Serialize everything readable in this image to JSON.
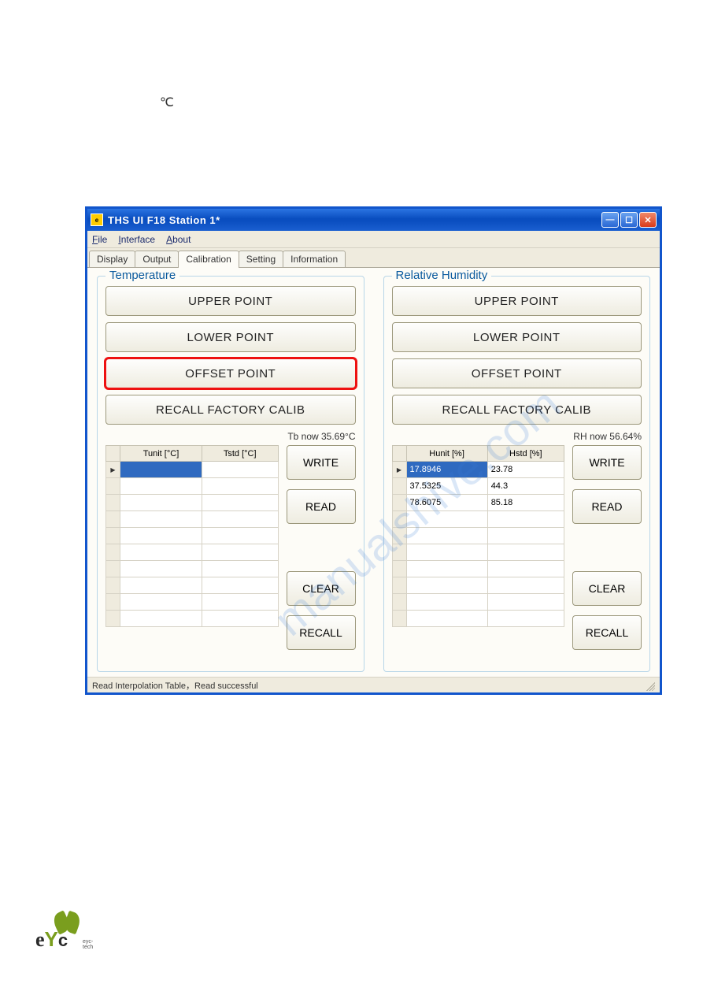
{
  "celsius_symbol": "℃",
  "window": {
    "title": "THS UI F18  Station 1*"
  },
  "menu": {
    "file": "File",
    "interface": "Interface",
    "about": "About"
  },
  "tabs": {
    "display": "Display",
    "output": "Output",
    "calibration": "Calibration",
    "setting": "Setting",
    "information": "Information"
  },
  "temp": {
    "legend": "Temperature",
    "upper": "UPPER POINT",
    "lower": "LOWER POINT",
    "offset": "OFFSET POINT",
    "recall_factory": "RECALL FACTORY CALIB",
    "now": "Tb now 35.69°C",
    "col1": "Tunit [°C]",
    "col2": "Tstd [°C]",
    "rows": [
      {
        "u": "",
        "s": ""
      },
      {
        "u": "",
        "s": ""
      },
      {
        "u": "",
        "s": ""
      },
      {
        "u": "",
        "s": ""
      },
      {
        "u": "",
        "s": ""
      },
      {
        "u": "",
        "s": ""
      },
      {
        "u": "",
        "s": ""
      },
      {
        "u": "",
        "s": ""
      },
      {
        "u": "",
        "s": ""
      },
      {
        "u": "",
        "s": ""
      }
    ]
  },
  "hum": {
    "legend": "Relative Humidity",
    "upper": "UPPER POINT",
    "lower": "LOWER POINT",
    "offset": "OFFSET POINT",
    "recall_factory": "RECALL FACTORY CALIB",
    "now": "RH now 56.64%",
    "col1": "Hunit [%]",
    "col2": "Hstd [%]",
    "rows": [
      {
        "u": "17.8946",
        "s": "23.78"
      },
      {
        "u": "37.5325",
        "s": "44.3"
      },
      {
        "u": "78.6075",
        "s": "85.18"
      },
      {
        "u": "",
        "s": ""
      },
      {
        "u": "",
        "s": ""
      },
      {
        "u": "",
        "s": ""
      },
      {
        "u": "",
        "s": ""
      },
      {
        "u": "",
        "s": ""
      },
      {
        "u": "",
        "s": ""
      },
      {
        "u": "",
        "s": ""
      }
    ]
  },
  "buttons": {
    "write": "WRITE",
    "read": "READ",
    "clear": "CLEAR",
    "recall": "RECALL"
  },
  "status": "Read Interpolation Table，Read successful",
  "watermark": "manualshive.com",
  "logo": {
    "text": "eYc",
    "sub": "eyc-tech"
  }
}
